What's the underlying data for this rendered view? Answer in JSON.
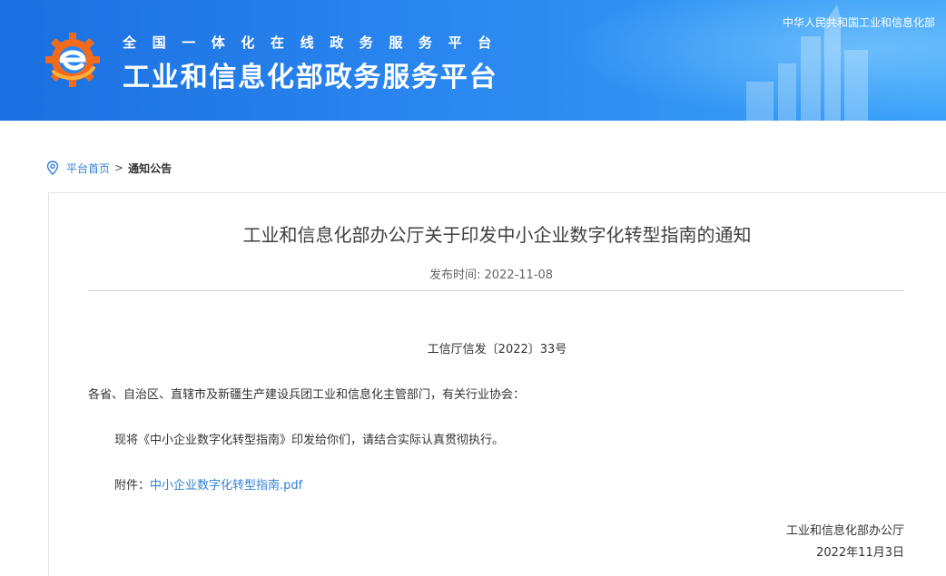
{
  "header": {
    "site_subtitle": "全国一体化在线政务服务平台",
    "site_title": "工业和信息化部政务服务平台",
    "ministry_link": "中华人民共和国工业和信息化部"
  },
  "breadcrumb": {
    "home": "平台首页",
    "separator": ">",
    "current": "通知公告"
  },
  "article": {
    "title": "工业和信息化部办公厅关于印发中小企业数字化转型指南的通知",
    "publish_label": "发布时间:",
    "publish_date": "2022-11-08",
    "doc_number": "工信厅信发〔2022〕33号",
    "addressee": "各省、自治区、直辖市及新疆生产建设兵团工业和信息化主管部门，有关行业协会：",
    "paragraph": "现将《中小企业数字化转型指南》印发给你们，请结合实际认真贯彻执行。",
    "attachment_label": "附件：",
    "attachment_name": "中小企业数字化转型指南.pdf",
    "signature_org": "工业和信息化部办公厅",
    "signature_date": "2022年11月3日"
  },
  "colors": {
    "header_start": "#1b6fe0",
    "header_end": "#3aa2f8",
    "link": "#2f7fd6",
    "logo_orange": "#f26b1d"
  },
  "icons": {
    "logo": "gear-e-logo",
    "breadcrumb": "location-pin-icon"
  }
}
